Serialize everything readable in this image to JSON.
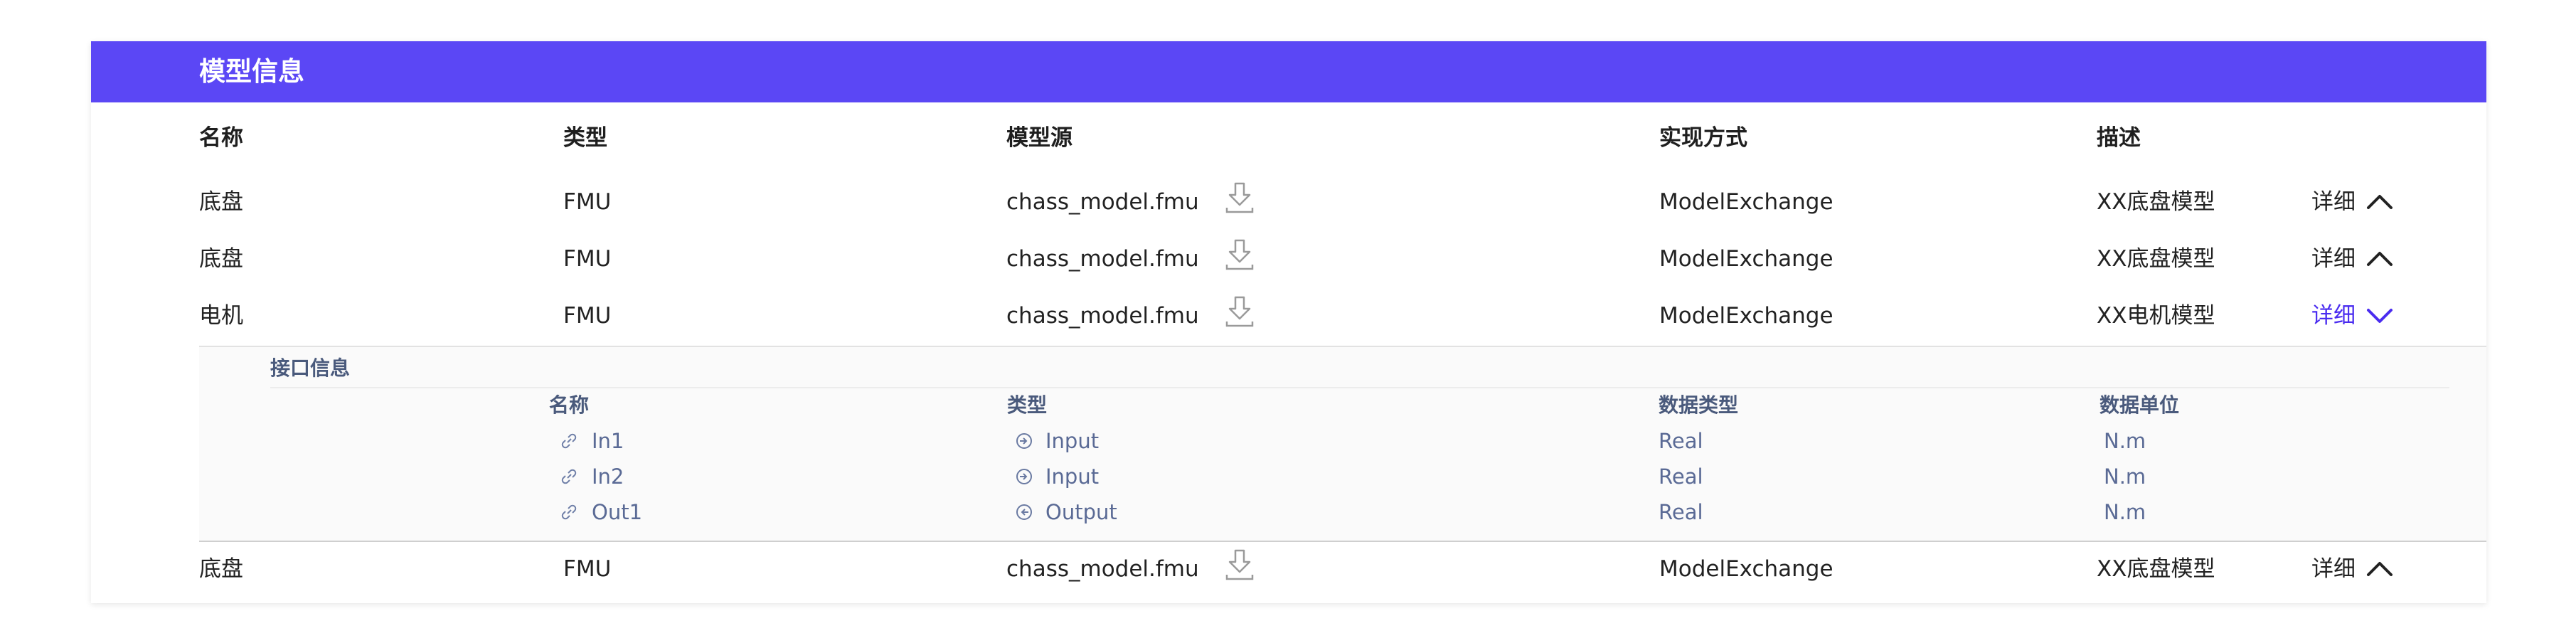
{
  "panel": {
    "title": "模型信息"
  },
  "columns": {
    "name": "名称",
    "type": "类型",
    "source": "模型源",
    "impl": "实现方式",
    "desc": "描述"
  },
  "rows": [
    {
      "name": "底盘",
      "type": "FMU",
      "source": "chass_model.fmu",
      "impl": "ModelExchange",
      "desc": "XX底盘模型",
      "detail": "详细",
      "expanded": false
    },
    {
      "name": "底盘",
      "type": "FMU",
      "source": "chass_model.fmu",
      "impl": "ModelExchange",
      "desc": "XX底盘模型",
      "detail": "详细",
      "expanded": false
    },
    {
      "name": "电机",
      "type": "FMU",
      "source": "chass_model.fmu",
      "impl": "ModelExchange",
      "desc": "XX电机模型",
      "detail": "详细",
      "expanded": true
    },
    {
      "name": "底盘",
      "type": "FMU",
      "source": "chass_model.fmu",
      "impl": "ModelExchange",
      "desc": "XX底盘模型",
      "detail": "详细",
      "expanded": false
    }
  ],
  "interface": {
    "title": "接口信息",
    "columns": {
      "name": "名称",
      "type": "类型",
      "dtype": "数据类型",
      "unit": "数据单位"
    },
    "items": [
      {
        "name": "In1",
        "type": "Input",
        "dtype": "Real",
        "unit": "N.m",
        "type_icon": "input-icon"
      },
      {
        "name": "In2",
        "type": "Input",
        "dtype": "Real",
        "unit": "N.m",
        "type_icon": "input-icon"
      },
      {
        "name": "Out1",
        "type": "Output",
        "dtype": "Real",
        "unit": "N.m",
        "type_icon": "output-icon"
      }
    ]
  },
  "colors": {
    "header": "#5b47f5",
    "active_link": "#4a2cf0",
    "sub_text": "#5a6a95"
  }
}
